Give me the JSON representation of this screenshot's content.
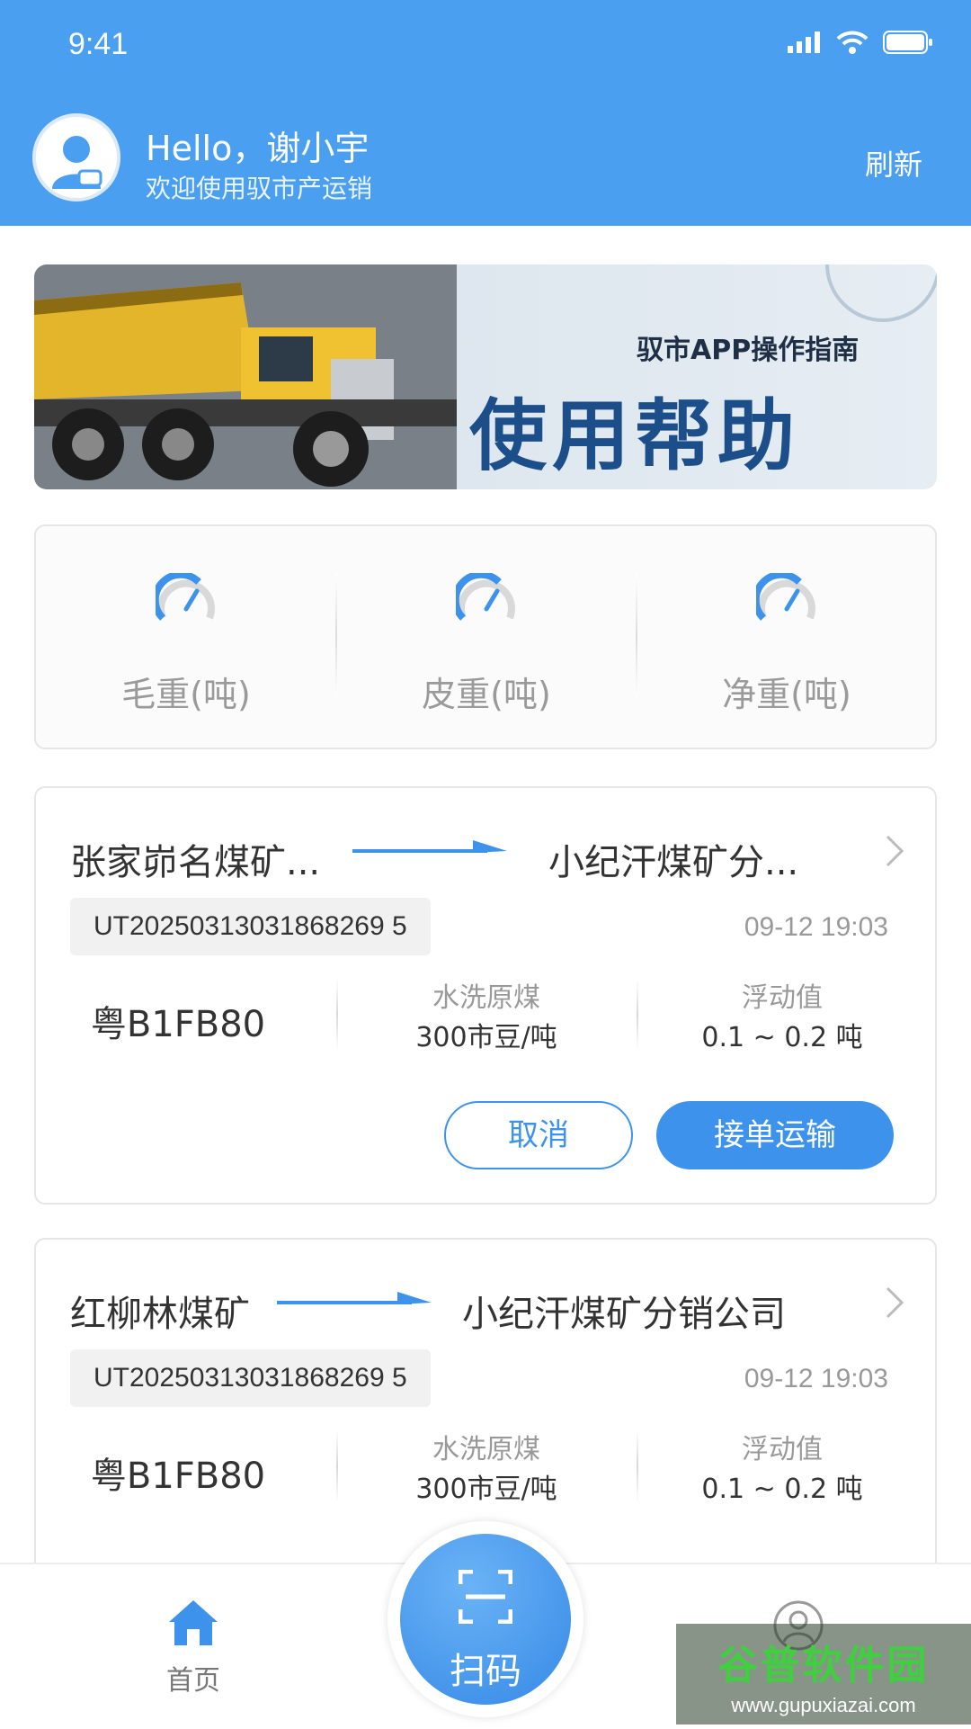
{
  "status_bar": {
    "time": "9:41"
  },
  "header": {
    "greeting": "Hello，谢小宇",
    "subtitle": "欢迎使用驭市产运销",
    "refresh_label": "刷新"
  },
  "banner": {
    "subtitle": "驭市APP操作指南",
    "title": "使用帮助"
  },
  "weights": [
    {
      "label": "毛重(吨)",
      "icon": "gauge-icon"
    },
    {
      "label": "皮重(吨)",
      "icon": "gauge-icon"
    },
    {
      "label": "净重(吨)",
      "icon": "gauge-icon"
    }
  ],
  "orders": [
    {
      "from": "张家峁名煤矿...",
      "to": "小纪汗煤矿分...",
      "order_no": "UT20250313031868269 5",
      "time": "09-12 19:03",
      "plate": "粤B1FB80",
      "cargo_name": "水洗原煤",
      "cargo_price": "300市豆/吨",
      "float_label": "浮动值",
      "float_value": "0.1 ~ 0.2 吨",
      "cancel_label": "取消",
      "accept_label": "接单运输"
    },
    {
      "from": "红柳林煤矿",
      "to": "小纪汗煤矿分销公司",
      "order_no": "UT20250313031868269 5",
      "time": "09-12 19:03",
      "plate": "粤B1FB80",
      "cargo_name": "水洗原煤",
      "cargo_price": "300市豆/吨",
      "float_label": "浮动值",
      "float_value": "0.1 ~ 0.2 吨"
    }
  ],
  "tabbar": {
    "home_label": "首页",
    "scan_label": "扫码"
  },
  "watermark": {
    "title": "谷普软件园",
    "url": "www.gupuxiazai.com"
  },
  "colors": {
    "primary": "#4a9ff0",
    "button": "#3d93ec"
  }
}
